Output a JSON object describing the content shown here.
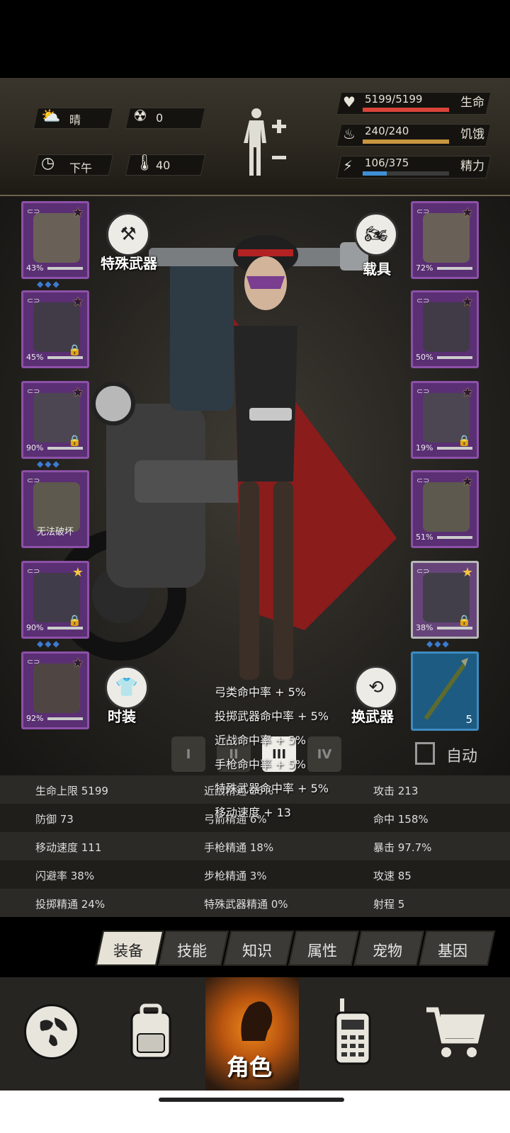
{
  "weather": {
    "label": "晴",
    "icon": "cloud-sun-icon"
  },
  "radiation": {
    "value": "0",
    "icon": "radiation-icon"
  },
  "time_of_day": {
    "label": "下午",
    "icon": "clock-icon"
  },
  "temperature": {
    "value": "40",
    "icon": "thermometer-icon"
  },
  "vitals": [
    {
      "label": "生命",
      "value": "5199/5199",
      "fill": 1.0,
      "color": "#d9443a",
      "icon": "heart-icon"
    },
    {
      "label": "饥饿",
      "value": "240/240",
      "fill": 1.0,
      "color": "#c9963f",
      "icon": "stomach-icon"
    },
    {
      "label": "精力",
      "value": "106/375",
      "fill": 0.28,
      "color": "#3f8fd6",
      "icon": "energy-icon"
    }
  ],
  "left_slots": [
    {
      "name": "helmet",
      "durability": "43%",
      "star": "outline",
      "locked": false,
      "dots": "◆◆◆"
    },
    {
      "name": "jacket",
      "durability": "45%",
      "star": "outline",
      "locked": true,
      "dots": ""
    },
    {
      "name": "coat",
      "durability": "90%",
      "star": "outline",
      "locked": true,
      "dots": "◆◆◆"
    },
    {
      "name": "backpack",
      "durability": "",
      "broken_label": "无法破坏",
      "star": "none",
      "locked": false,
      "dots": ""
    },
    {
      "name": "pants",
      "durability": "90%",
      "star": "gold",
      "locked": true,
      "dots": "◆◆◆"
    },
    {
      "name": "boots",
      "durability": "92%",
      "star": "outline",
      "locked": false,
      "dots": ""
    }
  ],
  "right_slots": [
    {
      "name": "goggles",
      "durability": "72%",
      "star": "outline",
      "locked": false
    },
    {
      "name": "gas-mask",
      "durability": "50%",
      "star": "outline",
      "locked": false
    },
    {
      "name": "vest",
      "durability": "19%",
      "star": "outline",
      "locked": true
    },
    {
      "name": "armband",
      "durability": "51%",
      "star": "outline",
      "locked": false
    },
    {
      "name": "pistol",
      "durability": "38%",
      "star": "gold",
      "locked": true,
      "dots": "◆◆◆"
    }
  ],
  "weapon_slot": {
    "count": "5"
  },
  "buttons": {
    "special_weapon": "特殊武器",
    "vehicle": "载具",
    "fashion": "时装",
    "switch_weapon": "换武器",
    "auto": "自动"
  },
  "bonuses": [
    "弓类命中率 + 5%",
    "投掷武器命中率 + 5%",
    "近战命中率 + 5%",
    "手枪命中率 + 5%",
    "特殊武器命中率 + 5%",
    "移动速度 + 13"
  ],
  "outfit_tabs": [
    "I",
    "II",
    "III",
    "IV"
  ],
  "stats": [
    [
      "生命上限 5199",
      "近战精通 26%",
      "攻击 213"
    ],
    [
      "防御 73",
      "弓箭精通 6%",
      "命中 158%"
    ],
    [
      "移动速度 111",
      "手枪精通 18%",
      "暴击 97.7%"
    ],
    [
      "闪避率 38%",
      "步枪精通 3%",
      "攻速 85"
    ],
    [
      "投掷精通 24%",
      "特殊武器精通 0%",
      "射程 5"
    ]
  ],
  "tabs": [
    "装备",
    "技能",
    "知识",
    "属性",
    "宠物",
    "基因"
  ],
  "active_tab": 0,
  "nav": [
    {
      "icon": "globe-icon",
      "label": ""
    },
    {
      "icon": "backpack-icon",
      "label": ""
    },
    {
      "icon": "character-icon",
      "label": "角色"
    },
    {
      "icon": "radio-icon",
      "label": ""
    },
    {
      "icon": "cart-icon",
      "label": ""
    }
  ]
}
